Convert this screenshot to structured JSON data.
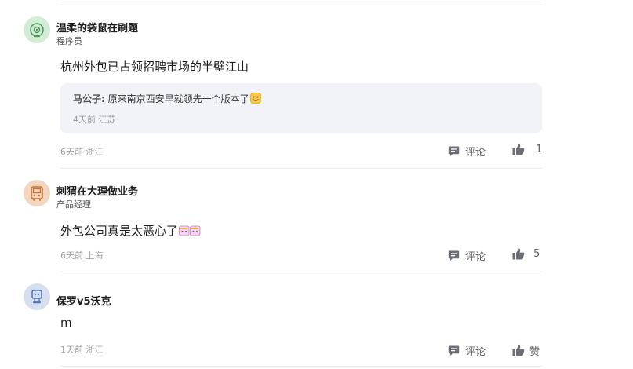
{
  "colors": {
    "icon_gray": "#6b6e75",
    "reply_bg": "#f2f3f8",
    "divider": "#eeeef0"
  },
  "comments": [
    {
      "avatar_icon": "green-camera-avatar",
      "avatar_bg": "#d3ecd6",
      "username": "温柔的袋鼠在刷题",
      "title": "程序员",
      "content": "杭州外包已占领招聘市场的半壁江山",
      "reply": {
        "author": "马公子:",
        "text": "原来南京西安早就领先一个版本了",
        "emoji": "smile-emoji",
        "time": "4天前",
        "location": "江苏"
      },
      "time": "6天前",
      "location": "浙江",
      "comment_label": "评论",
      "like_count": "1"
    },
    {
      "avatar_icon": "orange-bus-avatar",
      "avatar_bg": "#f2d6bf",
      "username": "刺猬在大理做业务",
      "title": "产品经理",
      "content": "外包公司真是太恶心了",
      "content_emoji": "sticker-emoji",
      "time": "6天前",
      "location": "上海",
      "comment_label": "评论",
      "like_count": "5"
    },
    {
      "avatar_icon": "blue-robot-avatar",
      "avatar_bg": "#d5dff0",
      "username": "保罗v5沃克",
      "title": "",
      "content": "m",
      "time": "1天前",
      "location": "浙江",
      "comment_label": "评论",
      "like_label": "赞"
    }
  ]
}
